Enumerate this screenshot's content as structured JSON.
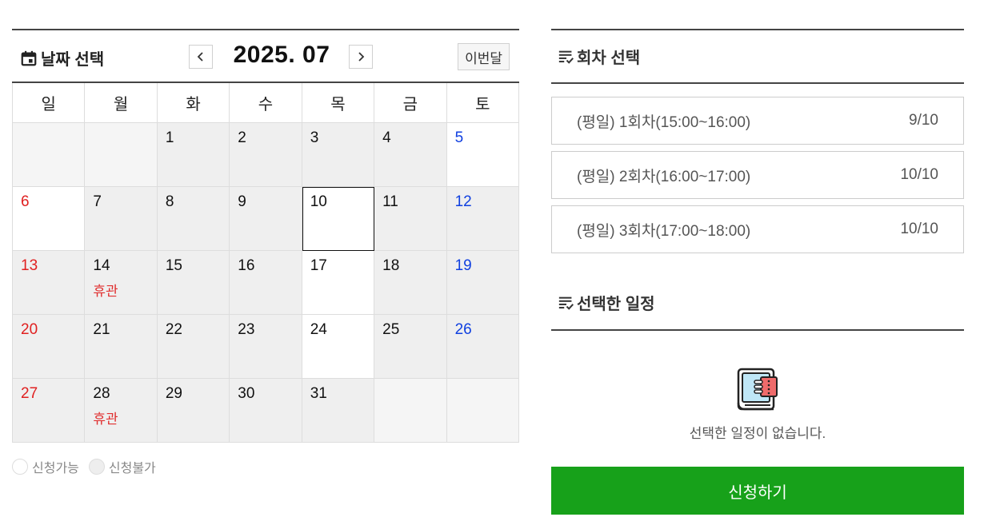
{
  "calendar": {
    "title": "날짜 선택",
    "month_label": "2025. 07",
    "this_month_label": "이번달",
    "weekdays": [
      "일",
      "월",
      "화",
      "수",
      "목",
      "금",
      "토"
    ],
    "days": [
      {
        "num": "",
        "note": "",
        "state": "empty"
      },
      {
        "num": "",
        "note": "",
        "state": "empty"
      },
      {
        "num": "1",
        "note": "",
        "state": "closed"
      },
      {
        "num": "2",
        "note": "",
        "state": "closed"
      },
      {
        "num": "3",
        "note": "",
        "state": "closed"
      },
      {
        "num": "4",
        "note": "",
        "state": "closed"
      },
      {
        "num": "5",
        "note": "",
        "state": "open"
      },
      {
        "num": "6",
        "note": "",
        "state": "open"
      },
      {
        "num": "7",
        "note": "",
        "state": "closed"
      },
      {
        "num": "8",
        "note": "",
        "state": "closed"
      },
      {
        "num": "9",
        "note": "",
        "state": "closed"
      },
      {
        "num": "10",
        "note": "",
        "state": "today"
      },
      {
        "num": "11",
        "note": "",
        "state": "closed"
      },
      {
        "num": "12",
        "note": "",
        "state": "closed"
      },
      {
        "num": "13",
        "note": "",
        "state": "closed"
      },
      {
        "num": "14",
        "note": "휴관",
        "state": "closed"
      },
      {
        "num": "15",
        "note": "",
        "state": "closed"
      },
      {
        "num": "16",
        "note": "",
        "state": "closed"
      },
      {
        "num": "17",
        "note": "",
        "state": "open"
      },
      {
        "num": "18",
        "note": "",
        "state": "closed"
      },
      {
        "num": "19",
        "note": "",
        "state": "closed"
      },
      {
        "num": "20",
        "note": "",
        "state": "closed"
      },
      {
        "num": "21",
        "note": "",
        "state": "closed"
      },
      {
        "num": "22",
        "note": "",
        "state": "closed"
      },
      {
        "num": "23",
        "note": "",
        "state": "closed"
      },
      {
        "num": "24",
        "note": "",
        "state": "open"
      },
      {
        "num": "25",
        "note": "",
        "state": "closed"
      },
      {
        "num": "26",
        "note": "",
        "state": "closed"
      },
      {
        "num": "27",
        "note": "",
        "state": "closed"
      },
      {
        "num": "28",
        "note": "휴관",
        "state": "closed"
      },
      {
        "num": "29",
        "note": "",
        "state": "closed"
      },
      {
        "num": "30",
        "note": "",
        "state": "closed"
      },
      {
        "num": "31",
        "note": "",
        "state": "closed"
      },
      {
        "num": "",
        "note": "",
        "state": "empty"
      },
      {
        "num": "",
        "note": "",
        "state": "empty"
      }
    ]
  },
  "legend": {
    "available": "신청가능",
    "unavailable": "신청불가"
  },
  "sessions": {
    "title": "회차 선택",
    "items": [
      {
        "label": "(평일) 1회차(15:00~16:00)",
        "count": "9/10"
      },
      {
        "label": "(평일) 2회차(16:00~17:00)",
        "count": "10/10"
      },
      {
        "label": "(평일) 3회차(17:00~18:00)",
        "count": "10/10"
      }
    ]
  },
  "selected": {
    "title": "선택한 일정",
    "empty_text": "선택한 일정이 없습니다."
  },
  "apply_label": "신청하기",
  "colors": {
    "sunday": "#e02020",
    "saturday": "#1040e0",
    "closed_note": "#e03030",
    "apply_button": "#17a11a",
    "closed_bg": "#efefef"
  }
}
